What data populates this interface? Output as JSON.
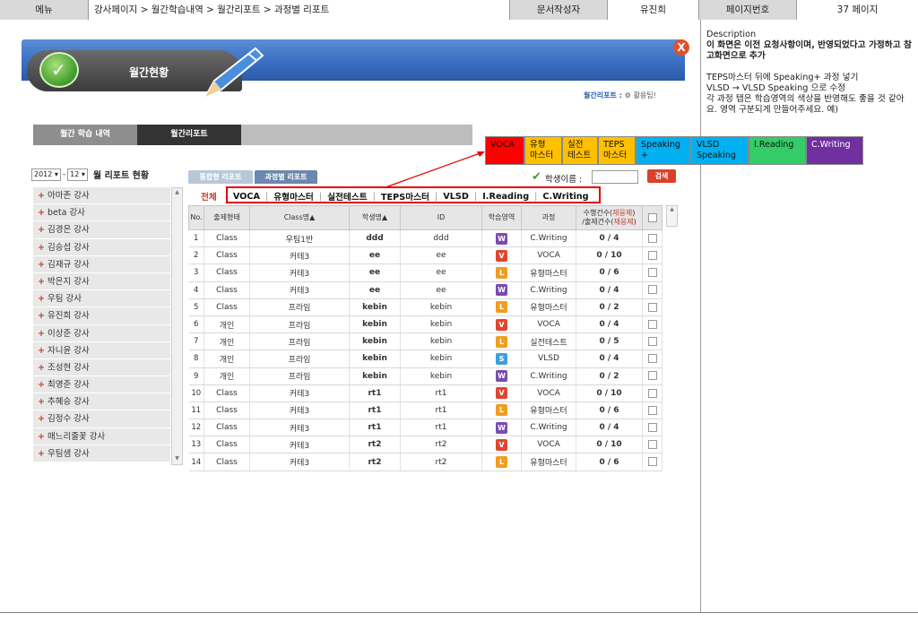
{
  "doc_header": {
    "menu_label": "메뉴",
    "breadcrumb": "강사페이지 > 월간학습내역 > 월간리포트 > 과정별 리포트",
    "author_label": "문서작성자",
    "author": "유진희",
    "page_label": "페이지번호",
    "page_value": "37 페이지"
  },
  "description": {
    "heading": "Description",
    "note": "이 화면은 이전 요청사항이며, 반영되었다고 가정하고 참고화면으로 추가",
    "line1": "TEPS마스터 뒤에 Speaking+ 과정 넣기",
    "line2": "VLSD → VLSD Speaking 으로 수정",
    "line3": "각 과정 탭은 학습영역의 색상을 반영해도 좋을 것 같아요. 영역 구분되게 만들어주세요. 예)"
  },
  "banner": {
    "title": "월간현황",
    "close_glyph": "X",
    "monthly_report_link": "월간리포트 :",
    "usage_text": "활용팁!"
  },
  "main_tabs": [
    "월간 학습 내역",
    "월간리포트"
  ],
  "legend_tabs": [
    {
      "label": "VOCA",
      "color": "#ff0000"
    },
    {
      "label": "유형\n마스터",
      "color": "#ffc000"
    },
    {
      "label": "실전\n테스트",
      "color": "#ffc000"
    },
    {
      "label": "TEPS\n마스터",
      "color": "#ffc000"
    },
    {
      "label": "Speaking\n+",
      "color": "#00b0f0"
    },
    {
      "label": "VLSD\nSpeaking",
      "color": "#00b0f0"
    },
    {
      "label": "I.Reading",
      "color": "#33cc66"
    },
    {
      "label": "C.Writing",
      "color": "#7030a0"
    }
  ],
  "month_selector": {
    "year": "2012",
    "month": "12",
    "dash": "-",
    "title": "월 리포트 현황"
  },
  "teachers": [
    "아마존 강사",
    "beta 강사",
    "김경은 강사",
    "김승섭 강사",
    "김재규 강사",
    "박은지 강사",
    "우팀 강사",
    "유진희 강사",
    "이상준 강사",
    "자니윤 강사",
    "조성현 강사",
    "최영준 강사",
    "추혜승 강사",
    "김정수 강사",
    "매느리줄꽃 강사",
    "우팀샘 강사"
  ],
  "sub_tabs": [
    "통합형 리포트",
    "과정별 리포트"
  ],
  "student_search": {
    "label": "학생이름 :",
    "value": "",
    "button": "검색"
  },
  "filters": {
    "all": "전체",
    "items": [
      "VOCA",
      "유형마스터",
      "실전테스트",
      "TEPS마스터",
      "VLSD",
      "I.Reading",
      "C.Writing"
    ]
  },
  "table": {
    "headers": {
      "no": "No.",
      "type": "출제형태",
      "class": "Class명▲",
      "student": "학생명▲",
      "id": "ID",
      "area": "학습영역",
      "course": "과정"
    },
    "progress_header": {
      "line1_a": "수행건수(",
      "line1_b": "재응제",
      "line1_c": ")",
      "line2_a": "/출제건수(",
      "line2_b": "재응제",
      "line2_c": ")"
    },
    "area_colors": {
      "W": "#7a4bb0",
      "V": "#e0462e",
      "L": "#f39c1f",
      "S": "#3d9ee0"
    },
    "rows": [
      {
        "no": "1",
        "type": "Class",
        "class": "우팀1반",
        "student": "ddd",
        "id": "ddd",
        "area": "W",
        "course": "C.Writing",
        "progress": "0 / 4"
      },
      {
        "no": "2",
        "type": "Class",
        "class": "커테3",
        "student": "ee",
        "id": "ee",
        "area": "V",
        "course": "VOCA",
        "progress": "0 / 10"
      },
      {
        "no": "3",
        "type": "Class",
        "class": "커테3",
        "student": "ee",
        "id": "ee",
        "area": "L",
        "course": "유형마스터",
        "progress": "0 / 6"
      },
      {
        "no": "4",
        "type": "Class",
        "class": "커테3",
        "student": "ee",
        "id": "ee",
        "area": "W",
        "course": "C.Writing",
        "progress": "0 / 4"
      },
      {
        "no": "5",
        "type": "Class",
        "class": "프라임",
        "student": "kebin",
        "id": "kebin",
        "area": "L",
        "course": "유형마스터",
        "progress": "0 / 2"
      },
      {
        "no": "6",
        "type": "개인",
        "class": "프라임",
        "student": "kebin",
        "id": "kebin",
        "area": "V",
        "course": "VOCA",
        "progress": "0 / 4"
      },
      {
        "no": "7",
        "type": "개인",
        "class": "프라임",
        "student": "kebin",
        "id": "kebin",
        "area": "L",
        "course": "실전테스트",
        "progress": "0 / 5"
      },
      {
        "no": "8",
        "type": "개인",
        "class": "프라임",
        "student": "kebin",
        "id": "kebin",
        "area": "S",
        "course": "VLSD",
        "progress": "0 / 4"
      },
      {
        "no": "9",
        "type": "개인",
        "class": "프라임",
        "student": "kebin",
        "id": "kebin",
        "area": "W",
        "course": "C.Writing",
        "progress": "0 / 2"
      },
      {
        "no": "10",
        "type": "Class",
        "class": "커테3",
        "student": "rt1",
        "id": "rt1",
        "area": "V",
        "course": "VOCA",
        "progress": "0 / 10"
      },
      {
        "no": "11",
        "type": "Class",
        "class": "커테3",
        "student": "rt1",
        "id": "rt1",
        "area": "L",
        "course": "유형마스터",
        "progress": "0 / 6"
      },
      {
        "no": "12",
        "type": "Class",
        "class": "커테3",
        "student": "rt1",
        "id": "rt1",
        "area": "W",
        "course": "C.Writing",
        "progress": "0 / 4"
      },
      {
        "no": "13",
        "type": "Class",
        "class": "커테3",
        "student": "rt2",
        "id": "rt2",
        "area": "V",
        "course": "VOCA",
        "progress": "0 / 10"
      },
      {
        "no": "14",
        "type": "Class",
        "class": "커테3",
        "student": "rt2",
        "id": "rt2",
        "area": "L",
        "course": "유형마스터",
        "progress": "0 / 6"
      }
    ]
  },
  "colors": {
    "highlight": "#e30000",
    "banner": "#3a6fc2",
    "accent_red": "#c63d2f"
  }
}
